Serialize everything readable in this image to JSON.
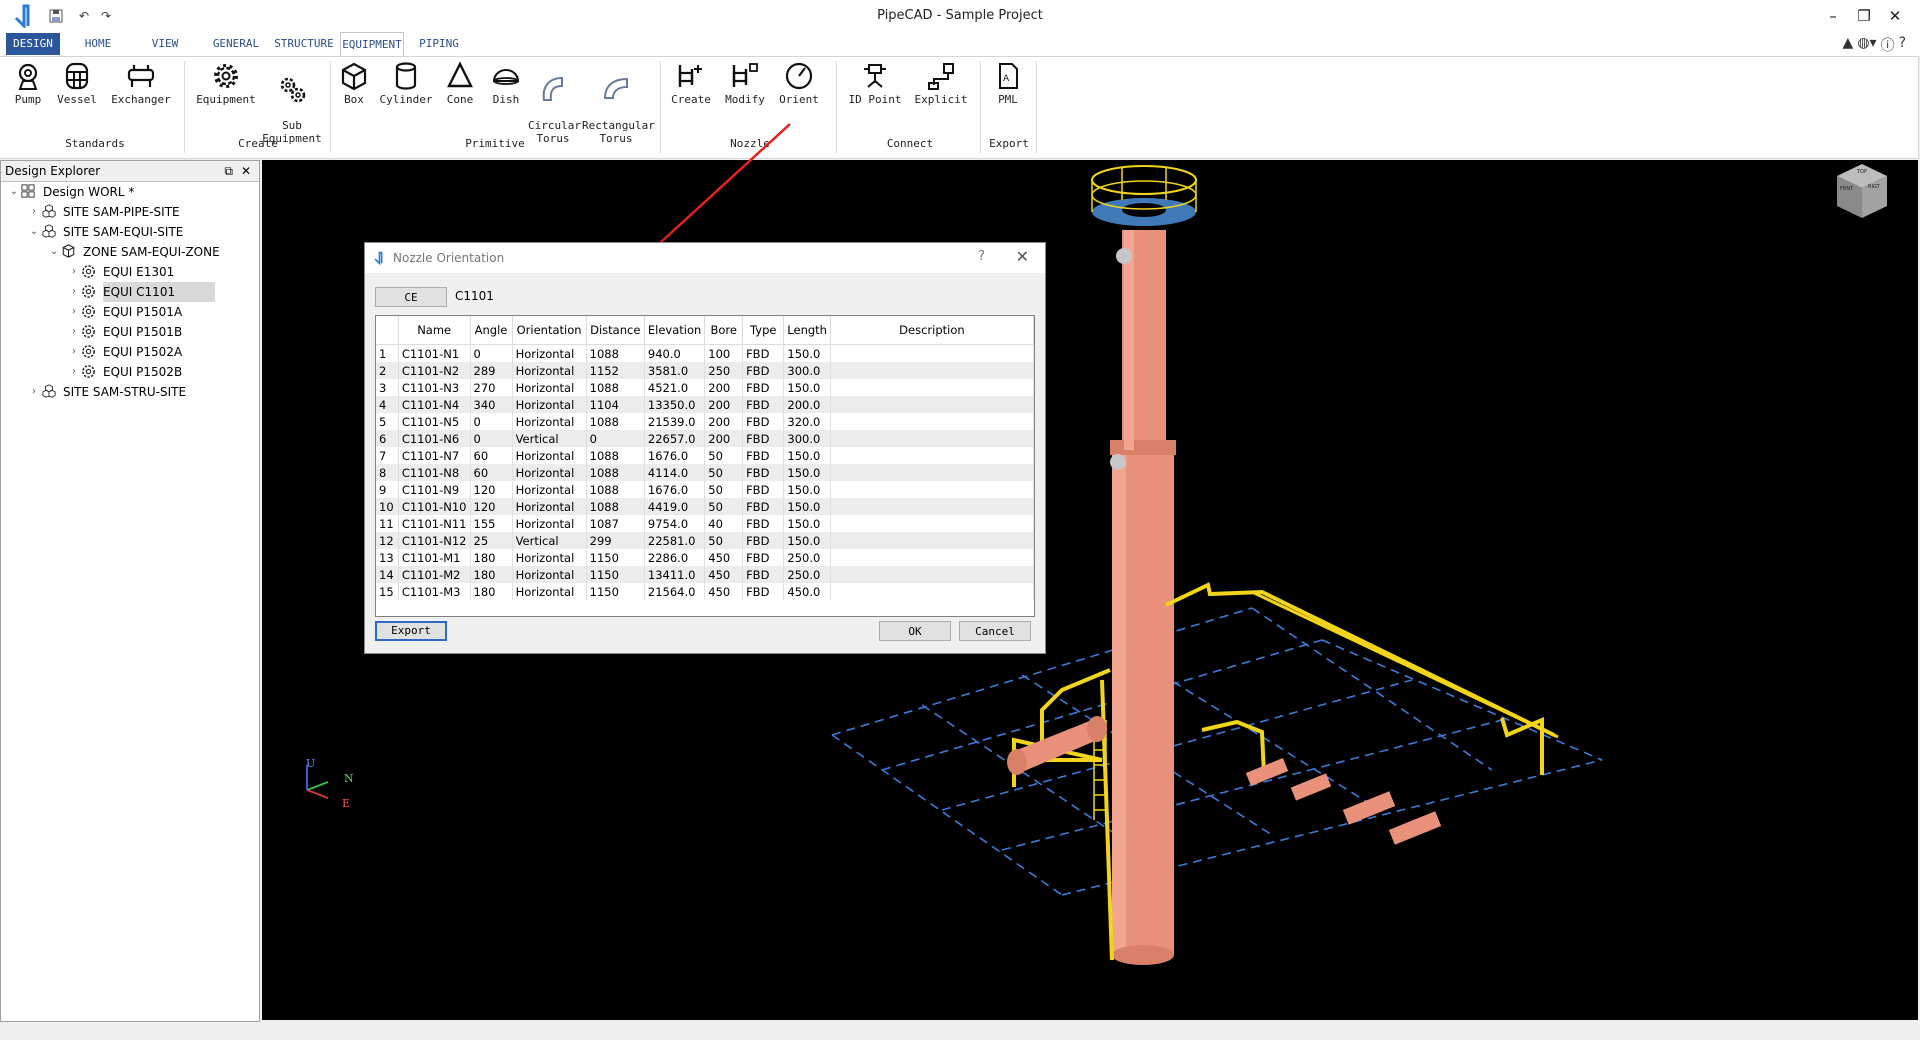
{
  "app": {
    "title": "PipeCAD - Sample Project"
  },
  "tabs": [
    "DESIGN",
    "HOME",
    "VIEW",
    "GENERAL",
    "STRUCTURE",
    "EQUIPMENT",
    "PIPING"
  ],
  "ribbon": {
    "groups": [
      {
        "label": "Standards",
        "buttons": [
          "Pump",
          "Vessel",
          "Exchanger"
        ]
      },
      {
        "label": "Create",
        "buttons": [
          "Equipment",
          "Sub\nEquipment"
        ]
      },
      {
        "label": "Primitive",
        "buttons": [
          "Box",
          "Cylinder",
          "Cone",
          "Dish",
          "Circular\nTorus",
          "Rectangular\nTorus"
        ]
      },
      {
        "label": "Nozzle",
        "buttons": [
          "Create",
          "Modify",
          "Orient"
        ]
      },
      {
        "label": "Connect",
        "buttons": [
          "ID Point",
          "Explicit"
        ]
      },
      {
        "label": "Export",
        "buttons": [
          "PML"
        ]
      }
    ]
  },
  "explorer": {
    "title": "Design Explorer",
    "items": [
      {
        "label": "Design WORL *",
        "level": 0,
        "icon": "world-icon",
        "expanded": true
      },
      {
        "label": "SITE SAM-PIPE-SITE",
        "level": 1,
        "icon": "site-icon",
        "expanded": false
      },
      {
        "label": "SITE SAM-EQUI-SITE",
        "level": 1,
        "icon": "site-icon",
        "expanded": true
      },
      {
        "label": "ZONE SAM-EQUI-ZONE",
        "level": 2,
        "icon": "zone-icon",
        "expanded": true
      },
      {
        "label": "EQUI E1301",
        "level": 3,
        "icon": "equipment-icon",
        "expanded": false
      },
      {
        "label": "EQUI C1101",
        "level": 3,
        "icon": "equipment-icon",
        "expanded": false,
        "selected": true
      },
      {
        "label": "EQUI P1501A",
        "level": 3,
        "icon": "equipment-icon",
        "expanded": false
      },
      {
        "label": "EQUI P1501B",
        "level": 3,
        "icon": "equipment-icon",
        "expanded": false
      },
      {
        "label": "EQUI P1502A",
        "level": 3,
        "icon": "equipment-icon",
        "expanded": false
      },
      {
        "label": "EQUI P1502B",
        "level": 3,
        "icon": "equipment-icon",
        "expanded": false
      },
      {
        "label": "SITE SAM-STRU-SITE",
        "level": 1,
        "icon": "site-icon",
        "expanded": false
      }
    ]
  },
  "dialog": {
    "title": "Nozzle Orientation",
    "ce_button": "CE",
    "ce_value": "C1101",
    "columns": [
      "Name",
      "Angle",
      "Orientation",
      "Distance",
      "Elevation",
      "Bore",
      "Type",
      "Length",
      "Description"
    ],
    "rows": [
      [
        "C1101-N1",
        "0",
        "Horizontal",
        "1088",
        "940.0",
        "100",
        "FBD",
        "150.0",
        ""
      ],
      [
        "C1101-N2",
        "289",
        "Horizontal",
        "1152",
        "3581.0",
        "250",
        "FBD",
        "300.0",
        ""
      ],
      [
        "C1101-N3",
        "270",
        "Horizontal",
        "1088",
        "4521.0",
        "200",
        "FBD",
        "150.0",
        ""
      ],
      [
        "C1101-N4",
        "340",
        "Horizontal",
        "1104",
        "13350.0",
        "200",
        "FBD",
        "200.0",
        ""
      ],
      [
        "C1101-N5",
        "0",
        "Horizontal",
        "1088",
        "21539.0",
        "200",
        "FBD",
        "320.0",
        ""
      ],
      [
        "C1101-N6",
        "0",
        "Vertical",
        "0",
        "22657.0",
        "200",
        "FBD",
        "300.0",
        ""
      ],
      [
        "C1101-N7",
        "60",
        "Horizontal",
        "1088",
        "1676.0",
        "50",
        "FBD",
        "150.0",
        ""
      ],
      [
        "C1101-N8",
        "60",
        "Horizontal",
        "1088",
        "4114.0",
        "50",
        "FBD",
        "150.0",
        ""
      ],
      [
        "C1101-N9",
        "120",
        "Horizontal",
        "1088",
        "1676.0",
        "50",
        "FBD",
        "150.0",
        ""
      ],
      [
        "C1101-N10",
        "120",
        "Horizontal",
        "1088",
        "4419.0",
        "50",
        "FBD",
        "150.0",
        ""
      ],
      [
        "C1101-N11",
        "155",
        "Horizontal",
        "1087",
        "9754.0",
        "40",
        "FBD",
        "150.0",
        ""
      ],
      [
        "C1101-N12",
        "25",
        "Vertical",
        "299",
        "22581.0",
        "50",
        "FBD",
        "150.0",
        ""
      ],
      [
        "C1101-M1",
        "180",
        "Horizontal",
        "1150",
        "2286.0",
        "450",
        "FBD",
        "250.0",
        ""
      ],
      [
        "C1101-M2",
        "180",
        "Horizontal",
        "1150",
        "13411.0",
        "450",
        "FBD",
        "250.0",
        ""
      ],
      [
        "C1101-M3",
        "180",
        "Horizontal",
        "1150",
        "21564.0",
        "450",
        "FBD",
        "450.0",
        ""
      ]
    ],
    "export_button": "Export",
    "ok_button": "OK",
    "cancel_button": "Cancel"
  },
  "axes": {
    "up": "U",
    "north": "N",
    "east": "E"
  },
  "viewcube": {
    "left": "FRNT",
    "right": "RIGT",
    "top": "TOP"
  }
}
